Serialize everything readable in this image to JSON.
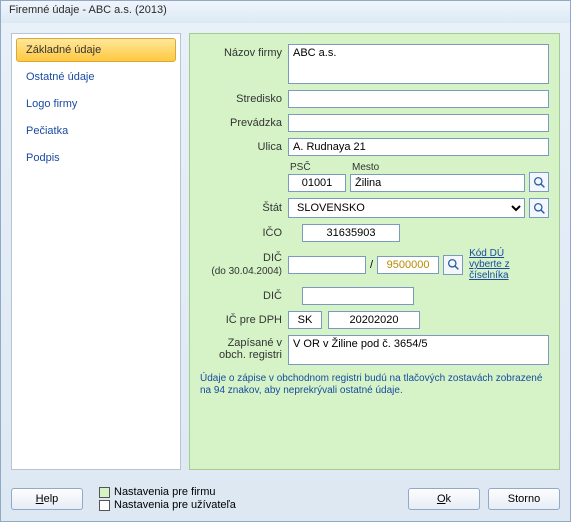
{
  "window": {
    "title": "Firemné údaje - ABC a.s. (2013)"
  },
  "sidebar": {
    "items": [
      {
        "label": "Základné údaje",
        "active": true
      },
      {
        "label": "Ostatné údaje"
      },
      {
        "label": "Logo firmy"
      },
      {
        "label": "Pečiatka"
      },
      {
        "label": "Podpis"
      }
    ]
  },
  "form": {
    "nazov_label": "Názov firmy",
    "nazov_value": "ABC a.s.",
    "stredisko_label": "Stredisko",
    "stredisko_value": "",
    "prevadzka_label": "Prevádzka",
    "prevadzka_value": "",
    "ulica_label": "Ulica",
    "ulica_value": "A. Rudnaya 21",
    "psc_label": "PSČ",
    "psc_value": "01001",
    "mesto_label": "Mesto",
    "mesto_value": "Žilina",
    "stat_label": "Štát",
    "stat_value": "SLOVENSKO",
    "ico_label": "IČO",
    "ico_value": "31635903",
    "dic_label": "DIČ",
    "dic_sub": "(do 30.04.2004)",
    "dic_value": "",
    "dic_sep": "/",
    "dic_right_value": "9500000",
    "kod_du_link": "Kód DÚ vyberte z číselníka",
    "dic2_label": "DIČ",
    "dic2_value": "",
    "icdph_label": "IČ pre DPH",
    "icdph_prefix": "SK",
    "icdph_value": "20202020",
    "register_label_1": "Zapísané v",
    "register_label_2": "obch. registri",
    "register_value": "V OR v Žiline pod č. 3654/5",
    "footnote": "Údaje o zápise v obchodnom registri budú na tlačových zostavách zobrazené na 94 znakov, aby neprekrývali ostatné údaje."
  },
  "footer": {
    "help": "Help",
    "legend_firm": "Nastavenia pre firmu",
    "legend_user": "Nastavenia pre užívateľa",
    "ok": "Ok",
    "storno": "Storno"
  }
}
